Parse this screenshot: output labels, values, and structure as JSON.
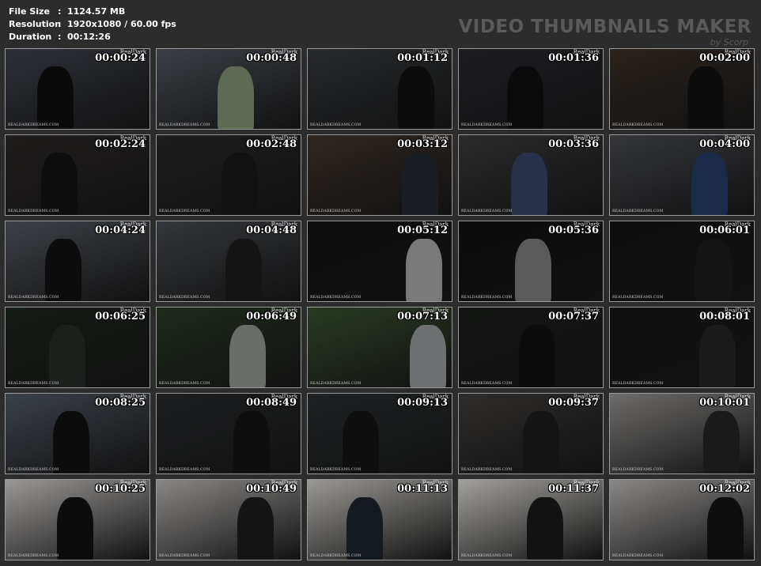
{
  "info": [
    {
      "key": "File Size",
      "sep": ":",
      "value": "1124.57 MB"
    },
    {
      "key": "Resolution",
      "sep": ":",
      "value": "1920x1080 / 60.00 fps"
    },
    {
      "key": "Duration",
      "sep": ":",
      "value": "00:12:26"
    }
  ],
  "brand": {
    "title": "VIDEO THUMBNAILS MAKER",
    "by": "by Scorp"
  },
  "watermark": {
    "top": "RealDark",
    "bottom": "REALDARKDREAMS.COM"
  },
  "thumbnails": [
    {
      "time": "00:00:24",
      "bg": "#2d3038",
      "fig": "#0a0a0a"
    },
    {
      "time": "00:00:48",
      "bg": "#3a3e44",
      "fig": "#5f6a55"
    },
    {
      "time": "00:01:12",
      "bg": "#26292c",
      "fig": "#0c0c0c"
    },
    {
      "time": "00:01:36",
      "bg": "#1c1c22",
      "fig": "#0b0b0b"
    },
    {
      "time": "00:02:00",
      "bg": "#2a221c",
      "fig": "#0c0c0c"
    },
    {
      "time": "00:02:24",
      "bg": "#201c1c",
      "fig": "#0d0d0d"
    },
    {
      "time": "00:02:48",
      "bg": "#1e1c1c",
      "fig": "#111111"
    },
    {
      "time": "00:03:12",
      "bg": "#2f2620",
      "fig": "#1a1d24"
    },
    {
      "time": "00:03:36",
      "bg": "#2a2a2c",
      "fig": "#28304a"
    },
    {
      "time": "00:04:00",
      "bg": "#34363a",
      "fig": "#1c2a4a"
    },
    {
      "time": "00:04:24",
      "bg": "#3c4046",
      "fig": "#0c0c0c"
    },
    {
      "time": "00:04:48",
      "bg": "#33363a",
      "fig": "#141414"
    },
    {
      "time": "00:05:12",
      "bg": "#0d0d0d",
      "fig": "#7a7a7a"
    },
    {
      "time": "00:05:36",
      "bg": "#0b0b0b",
      "fig": "#5a5a5a"
    },
    {
      "time": "00:06:01",
      "bg": "#0e0e0e",
      "fig": "#141414"
    },
    {
      "time": "00:06:25",
      "bg": "#141a14",
      "fig": "#1c201c"
    },
    {
      "time": "00:06:49",
      "bg": "#1e2a1c",
      "fig": "#6a6e6a"
    },
    {
      "time": "00:07:13",
      "bg": "#2a3a24",
      "fig": "#6e7072"
    },
    {
      "time": "00:07:37",
      "bg": "#121412",
      "fig": "#0c0c0c"
    },
    {
      "time": "00:08:01",
      "bg": "#101010",
      "fig": "#1a1a1a"
    },
    {
      "time": "00:08:25",
      "bg": "#3a4048",
      "fig": "#0c0c0c"
    },
    {
      "time": "00:08:49",
      "bg": "#1c1e20",
      "fig": "#0e0e0e"
    },
    {
      "time": "00:09:13",
      "bg": "#1e2224",
      "fig": "#0e0e0e"
    },
    {
      "time": "00:09:37",
      "bg": "#2e2c2a",
      "fig": "#141414"
    },
    {
      "time": "00:10:01",
      "bg": "#6e6c6a",
      "fig": "#1a1a1a"
    },
    {
      "time": "00:10:25",
      "bg": "#9a9896",
      "fig": "#0c0c0c"
    },
    {
      "time": "00:10:49",
      "bg": "#8a8886",
      "fig": "#141414"
    },
    {
      "time": "00:11:13",
      "bg": "#9a9894",
      "fig": "#141a20"
    },
    {
      "time": "00:11:37",
      "bg": "#a2a09c",
      "fig": "#121212"
    },
    {
      "time": "00:12:02",
      "bg": "#8a8886",
      "fig": "#0e0e0e"
    }
  ]
}
